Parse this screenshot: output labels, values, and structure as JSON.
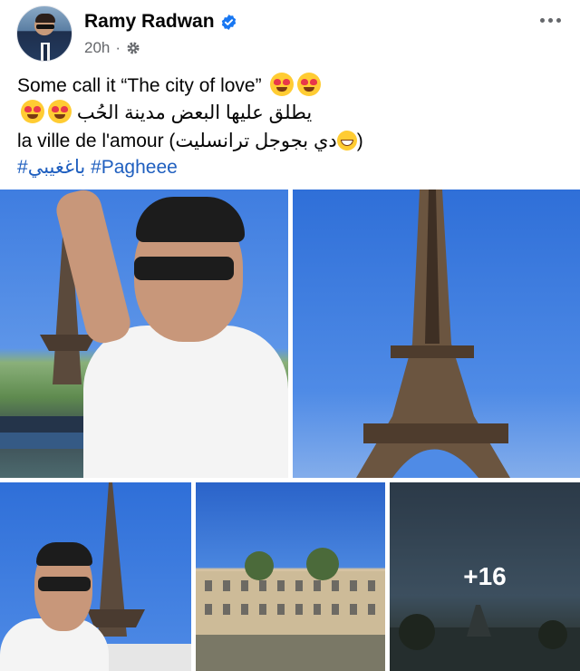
{
  "post": {
    "author": "Ramy Radwan",
    "time": "20h",
    "separator": "·",
    "text_line1": "Some call it “The city of love”",
    "text_line2": "يطلق عليها البعض مدينة الحُب",
    "text_line3": "la ville de l'amour (دي بجوجل ترانسليت",
    "text_line3_end": ")",
    "hashtags": "#باغغيبي #Pagheee"
  },
  "icons": {
    "verified": "verified-badge-icon",
    "audience": "gear-icon",
    "more": "more-options-icon",
    "emoji_heart_eyes": "heart-eyes-emoji",
    "emoji_grin": "grinning-emoji"
  },
  "photos": {
    "more_count": "+16"
  },
  "colors": {
    "link": "#1f5fbf",
    "verified": "#1877f2",
    "muted": "#65676b"
  }
}
